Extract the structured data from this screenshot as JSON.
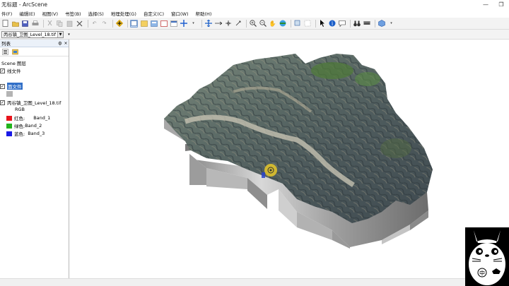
{
  "window": {
    "title": "无标题 - ArcScene",
    "buttons": [
      "—",
      "❐"
    ]
  },
  "menubar": {
    "items": [
      "件(F)",
      "编辑(E)",
      "视图(V)",
      "书签(B)",
      "选择(S)",
      "地理处理(G)",
      "自定义(C)",
      "窗口(W)",
      "帮助(H)"
    ]
  },
  "layer_dropdown": {
    "value": "丙谷镇_卫图_Level_18.tif"
  },
  "toc": {
    "title": "列表",
    "pin": "ф",
    "close": "×",
    "scene_layers_label": "Scene 图层",
    "items": [
      {
        "label": "线文件",
        "checked": true
      },
      {
        "label": "面文件",
        "checked": true,
        "selected": true
      },
      {
        "label": "丙谷镇_卫图_Level_18.tif",
        "checked": true
      }
    ],
    "rgb_label": "RGB",
    "bands": [
      {
        "channel": "红色:",
        "band": "Band_1",
        "color": "#e8141c"
      },
      {
        "channel": "绿色:",
        "band": "Band_2",
        "color": "#22b41c"
      },
      {
        "channel": "蓝色:",
        "band": "Band_3",
        "color": "#1a1ae6"
      }
    ],
    "polygon_swatch_color": "#b4b4b4"
  },
  "icons": {
    "toolbar1": [
      "new-icon",
      "open-icon",
      "save-icon",
      "print-icon",
      "cut-icon",
      "copy-icon",
      "paste-icon",
      "delete-icon",
      "undo-icon",
      "redo-icon",
      "add-data-icon",
      "layout-icon",
      "catalog-icon",
      "toc-icon",
      "arcmap-icon",
      "python-icon",
      "select-icon",
      "editor-icon"
    ],
    "toolbar2": [
      "navigate-icon",
      "fly-icon",
      "center-icon",
      "zoom-target-icon",
      "zoom-in-icon",
      "zoom-out-icon",
      "pan-icon",
      "full-extent-icon",
      "select-features-icon",
      "clear-selection-icon",
      "pointer-icon",
      "identify-icon",
      "html-popup-icon",
      "find-icon",
      "measure-icon",
      "scene-properties-icon"
    ]
  }
}
